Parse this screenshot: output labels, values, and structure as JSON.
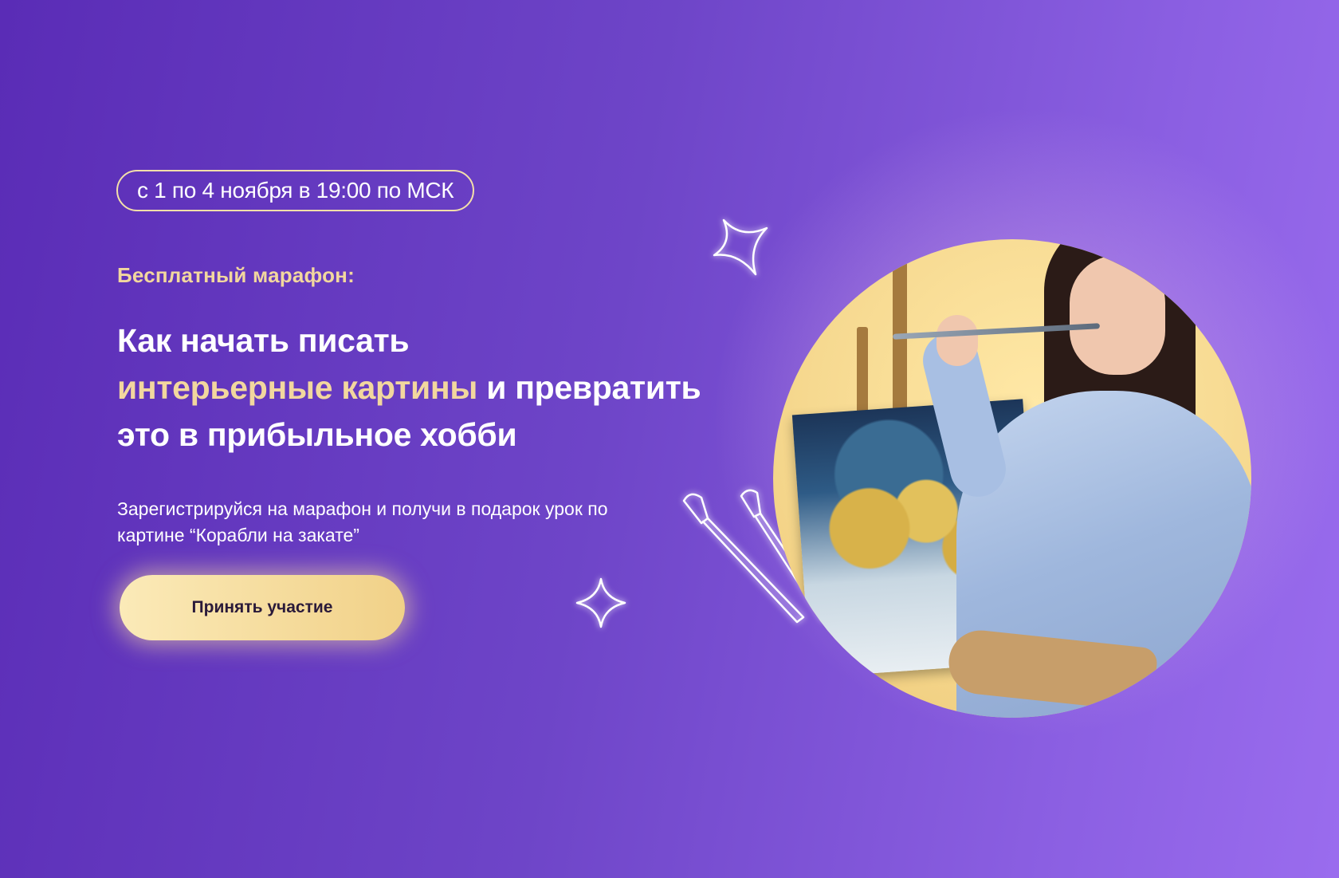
{
  "hero": {
    "date_badge": "с 1 по 4 ноября в 19:00 по МСК",
    "eyebrow": "Бесплатный марафон:",
    "headline": {
      "line1": "Как начать писать",
      "line2_accent": "интерьерные картины",
      "line2_rest": " и превратить",
      "line3": "это в прибыльное хобби"
    },
    "subtext": "Зарегистрируйся на марафон и получи в подарок урок по картине “Корабли на закате”",
    "cta_label": "Принять участие"
  },
  "colors": {
    "background_start": "#5a2cb6",
    "background_end": "#9a6cee",
    "accent_gold": "#f2d79e",
    "cta_gradient_start": "#fbeab8",
    "cta_gradient_end": "#f1d188",
    "text_primary": "#ffffff",
    "cta_text": "#2a1a3a"
  },
  "icons": {
    "sparkle_top": "sparkle-icon",
    "sparkle_bottom": "sparkle-icon",
    "brushes": "paint-brushes-icon"
  }
}
